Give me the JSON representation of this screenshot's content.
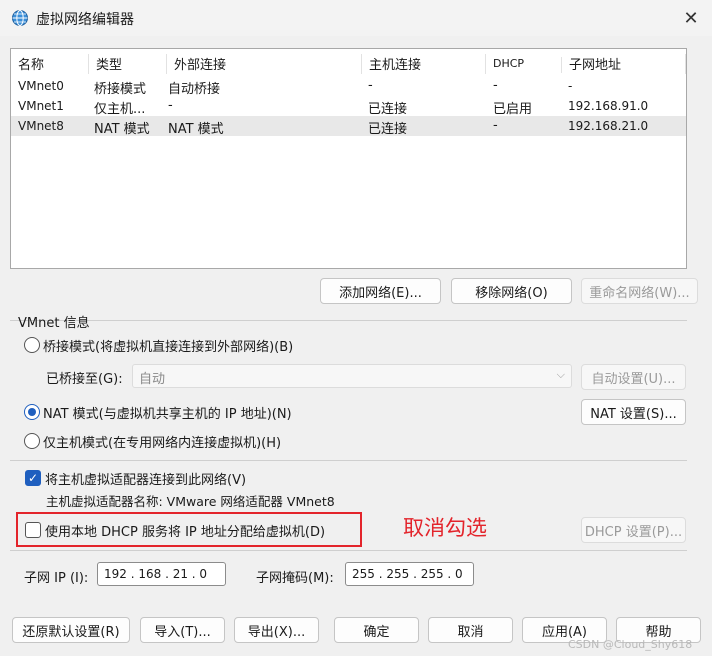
{
  "window": {
    "title": "虚拟网络编辑器"
  },
  "table": {
    "headers": [
      "名称",
      "类型",
      "外部连接",
      "主机连接",
      "DHCP",
      "子网地址"
    ],
    "rows": [
      [
        "VMnet0",
        "桥接模式",
        "自动桥接",
        "-",
        "-",
        "-"
      ],
      [
        "VMnet1",
        "仅主机...",
        "-",
        "已连接",
        "已启用",
        "192.168.91.0"
      ],
      [
        "VMnet8",
        "NAT 模式",
        "NAT 模式",
        "已连接",
        "-",
        "192.168.21.0"
      ]
    ],
    "selected_row": 2
  },
  "list_buttons": {
    "add": "添加网络(E)...",
    "remove": "移除网络(O)",
    "rename": "重命名网络(W)..."
  },
  "vmnet_info": {
    "group_label": "VMnet 信息",
    "bridge_radio": "桥接模式(将虚拟机直接连接到外部网络)(B)",
    "bridged_to_label": "已桥接至(G):",
    "bridged_to_value": "自动",
    "auto_settings": "自动设置(U)...",
    "nat_radio": "NAT 模式(与虚拟机共享主机的 IP 地址)(N)",
    "nat_settings": "NAT 设置(S)...",
    "host_only_radio": "仅主机模式(在专用网络内连接虚拟机)(H)",
    "connect_adapter_checkbox": "将主机虚拟适配器连接到此网络(V)",
    "adapter_name_text": "主机虚拟适配器名称: VMware 网络适配器 VMnet8",
    "dhcp_checkbox": "使用本地 DHCP 服务将 IP 地址分配给虚拟机(D)",
    "dhcp_settings": "DHCP 设置(P)...",
    "annotation": "取消勾选",
    "subnet_ip_label": "子网 IP (I):",
    "subnet_ip_value": "192 . 168 . 21 . 0",
    "subnet_mask_label": "子网掩码(M):",
    "subnet_mask_value": "255 . 255 . 255 . 0"
  },
  "footer": {
    "restore": "还原默认设置(R)",
    "import": "导入(T)...",
    "export": "导出(X)...",
    "ok": "确定",
    "cancel": "取消",
    "apply": "应用(A)",
    "help": "帮助"
  },
  "watermark": "CSDN @Cloud_Shy618",
  "colors": {
    "accent": "#1f5fbf",
    "annotation": "#e3242b"
  }
}
